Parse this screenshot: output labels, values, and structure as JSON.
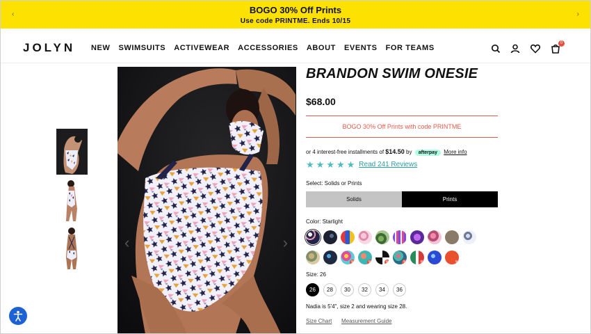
{
  "promo": {
    "title": "BOGO 30% Off Prints",
    "subtitle": "Use code PRINTME. Ends 10/15"
  },
  "header": {
    "logo": "JOLYN",
    "nav": [
      "NEW",
      "SWIMSUITS",
      "ACTIVEWEAR",
      "ACCESSORIES",
      "ABOUT",
      "EVENTS",
      "FOR TEAMS"
    ],
    "icons": [
      "search-icon",
      "user-icon",
      "heart-icon",
      "cart-icon"
    ],
    "cart_count": "0"
  },
  "product": {
    "title": "BRANDON SWIM ONESIE",
    "price": "$68.00",
    "promo": "BOGO 30% Off Prints with code PRINTME",
    "afterpay": {
      "prefix": "or 4 interest-free installments of",
      "amount": "$14.50",
      "by": "by",
      "brand": "afterpay",
      "link": "More info"
    },
    "rating": 5,
    "reviews_link": "Read 241 Reviews",
    "select_label": "Select: Solids or Prints",
    "options": [
      "Solids",
      "Prints"
    ],
    "selected_option": "Prints",
    "color_label": "Color: Starlight",
    "size_label": "Size: 26",
    "sizes": [
      "26",
      "28",
      "30",
      "32",
      "34",
      "36"
    ],
    "selected_size": "26",
    "model_note": "Nadia is 5'4\", size 2 and wearing size 28.",
    "size_chart": "Size Chart",
    "measurement_guide": "Measurement Guide",
    "sale_badge": "%"
  },
  "colors": {
    "accent": "#fde100",
    "promo_red": "#e25b4a",
    "teal": "#4cbcc0",
    "a11y_blue": "#1c62d4"
  }
}
